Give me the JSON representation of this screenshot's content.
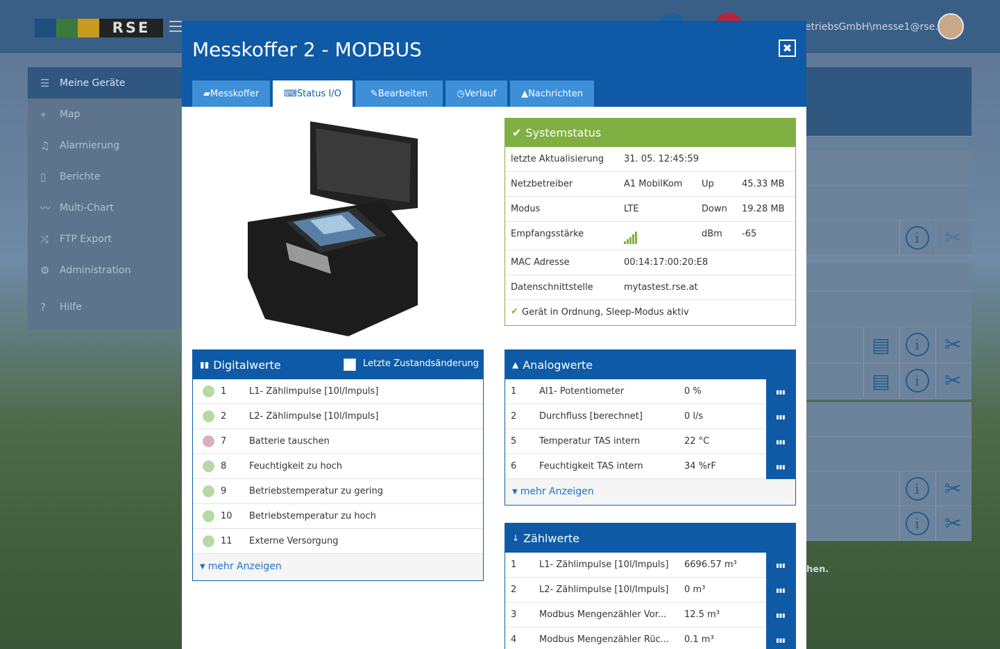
{
  "header": {
    "logo_text": "RSE",
    "user": "etriebsGmbH\\messe1@rse.at"
  },
  "sidebar": {
    "items": [
      {
        "label": "Meine Geräte",
        "icon": "list-icon"
      },
      {
        "label": "Map",
        "icon": "map-pin-icon"
      },
      {
        "label": "Alarmierung",
        "icon": "bell-icon"
      },
      {
        "label": "Berichte",
        "icon": "report-icon"
      },
      {
        "label": "Multi-Chart",
        "icon": "chart-line-icon"
      },
      {
        "label": "FTP Export",
        "icon": "shuffle-icon"
      },
      {
        "label": "Administration",
        "icon": "gear-icon"
      },
      {
        "label": "Hilfe",
        "icon": "question-icon"
      }
    ]
  },
  "background_text": "hen.",
  "modal": {
    "title": "Messkoffer 2 - MODBUS",
    "close": "✖",
    "tabs": [
      "Messkoffer",
      "Status I/O",
      "Bearbeiten",
      "Verlauf",
      "Nachrichten"
    ],
    "systemstatus": {
      "title": "Systemstatus",
      "last_update_label": "letzte Aktualisierung",
      "last_update": "31. 05. 12:45:59",
      "provider_label": "Netzbetreiber",
      "provider": "A1 MobilKom",
      "up_label": "Up",
      "up": "45.33 MB",
      "mode_label": "Modus",
      "mode": "LTE",
      "down_label": "Down",
      "down": "19.28 MB",
      "signal_label": "Empfangsstärke",
      "dbm_label": "dBm",
      "dbm": "-65",
      "mac_label": "MAC Adresse",
      "mac": "00:14:17:00:20:E8",
      "interface_label": "Datenschnittstelle",
      "interface": "mytastest.rse.at",
      "status": "Gerät in Ordnung, Sleep-Modus aktiv"
    },
    "digital": {
      "title": "Digitalwerte",
      "last_change": "Letzte Zustandsänderung",
      "rows": [
        {
          "no": "1",
          "label": "L1- Zählimpulse [10l/Impuls]",
          "state": "ok"
        },
        {
          "no": "2",
          "label": "L2- Zählimpulse [10l/Impuls]",
          "state": "ok"
        },
        {
          "no": "7",
          "label": "Batterie tauschen",
          "state": "alarm"
        },
        {
          "no": "8",
          "label": "Feuchtigkeit zu hoch",
          "state": "ok"
        },
        {
          "no": "9",
          "label": "Betriebstemperatur zu gering",
          "state": "ok"
        },
        {
          "no": "10",
          "label": "Betriebstemperatur zu hoch",
          "state": "ok"
        },
        {
          "no": "11",
          "label": "Externe Versorgung",
          "state": "ok"
        }
      ],
      "more": "mehr Anzeigen"
    },
    "analog": {
      "title": "Analogwerte",
      "rows": [
        {
          "no": "1",
          "label": "AI1- Potentiometer",
          "value": "0 %"
        },
        {
          "no": "2",
          "label": "Durchfluss [berechnet]",
          "value": "0 l/s"
        },
        {
          "no": "5",
          "label": "Temperatur TAS intern",
          "value": "22 °C"
        },
        {
          "no": "6",
          "label": "Feuchtigkeit TAS intern",
          "value": "34 %rF"
        }
      ],
      "more": "mehr Anzeigen"
    },
    "counters": {
      "title": "Zählwerte",
      "rows": [
        {
          "no": "1",
          "label": "L1- Zählimpulse [10l/Impuls]",
          "value": "6696.57 m³"
        },
        {
          "no": "2",
          "label": "L2- Zählimpulse [10l/Impuls]",
          "value": "0 m³"
        },
        {
          "no": "3",
          "label": "Modbus Mengenzähler Vor...",
          "value": "12.5 m³"
        },
        {
          "no": "4",
          "label": "Modbus Mengenzähler Rüc...",
          "value": "0.1 m³"
        }
      ]
    }
  }
}
